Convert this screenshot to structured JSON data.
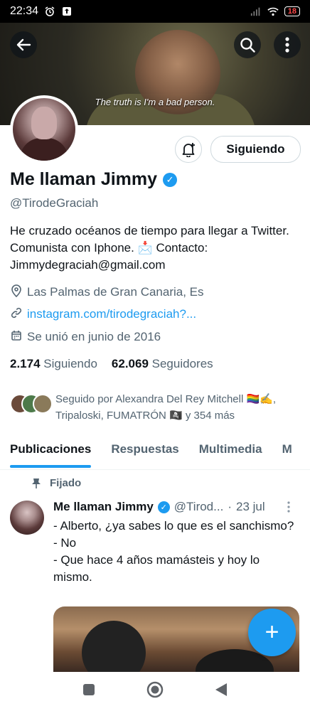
{
  "status_bar": {
    "time": "22:34",
    "battery": "18"
  },
  "banner": {
    "caption": "The truth is I'm a bad person."
  },
  "profile": {
    "follow_label": "Siguiendo",
    "name": "Me llaman Jimmy",
    "handle": "@TirodeGraciah",
    "bio": "He cruzado océanos de tiempo para llegar a Twitter. Comunista con Iphone. 📩 Contacto: Jimmydegraciah@gmail.com",
    "location": "Las Palmas de Gran Canaria, Es",
    "link": "instagram.com/tirodegraciah?...",
    "joined": "Se unió en junio de 2016",
    "following_count": "2.174",
    "following_label": "Siguiendo",
    "followers_count": "62.069",
    "followers_label": "Seguidores",
    "followed_by": "Seguido por Alexandra Del Rey Mitchell 🏳️‍🌈✍️, Tripaloski, FUMATRÓN 🏴‍☠️ y 354 más"
  },
  "tabs": [
    {
      "label": "Publicaciones"
    },
    {
      "label": "Respuestas"
    },
    {
      "label": "Multimedia"
    },
    {
      "label": "M"
    }
  ],
  "tweet": {
    "pinned_label": "Fijado",
    "name": "Me llaman Jimmy",
    "handle": "@Tirod...",
    "separator": "·",
    "date": "23 jul",
    "text_lines": [
      "- Alberto, ¿ya sabes lo que es el sanchismo?",
      "- No",
      "- Que hace 4 años mamásteis y hoy lo mismo."
    ]
  },
  "fab": {
    "label": "+"
  },
  "colors": {
    "accent": "#1d9bf0",
    "text": "#0f1419",
    "secondary": "#536471"
  }
}
